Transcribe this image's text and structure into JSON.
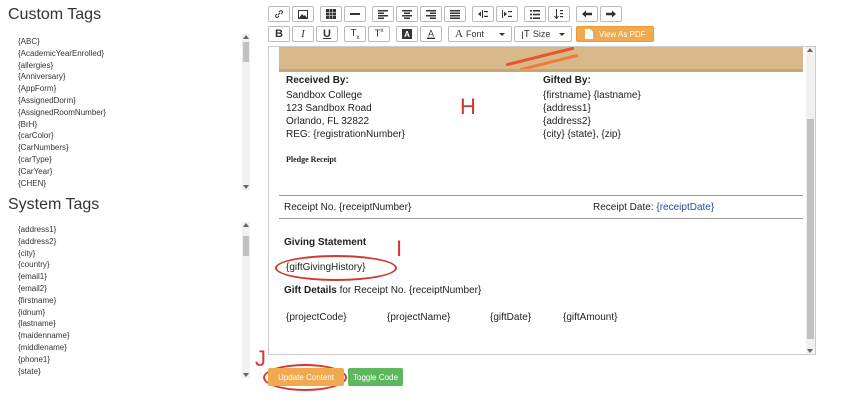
{
  "custom_tags": {
    "title": "Custom Tags",
    "items": [
      "{ABC}",
      "{AcademicYearEnrolled}",
      "{allergies}",
      "{Anniversary}",
      "{AppForm}",
      "{AssignedDorm}",
      "{AssignedRoomNumber}",
      "{BrH}",
      "{carColor}",
      "{CarNumbers}",
      "{carType}",
      "{CarYear}",
      "{CHEN}"
    ]
  },
  "system_tags": {
    "title": "System Tags",
    "items": [
      "{address1}",
      "{address2}",
      "{city}",
      "{country}",
      "{email1}",
      "{email2}",
      "{firstname}",
      "{idnum}",
      "{lastname}",
      "{maidenname}",
      "{middlename}",
      "{phone1}",
      "{state}"
    ]
  },
  "toolbar": {
    "font_label": "Font",
    "size_label": "Size",
    "view_pdf_label": "View As PDF",
    "pdf_color": "#f0a94e"
  },
  "document": {
    "received_by_heading": "Received By:",
    "received_lines": [
      "Sandbox College",
      "123 Sandbox Road",
      "Orlando, FL 32822",
      "REG: {registrationNumber}"
    ],
    "gifted_by_heading": "Gifted By:",
    "gifted_lines": [
      "{firstname} {lastname}",
      "{address1}",
      "{address2}",
      "{city} {state}, {zip}"
    ],
    "pledge_receipt": "Pledge Receipt",
    "receipt_no": "Receipt No. {receiptNumber}",
    "receipt_date_label": "Receipt Date:",
    "receipt_date_value": "{receiptDate}",
    "giving_statement": "Giving Statement",
    "gift_giving_history": "{giftGivingHistory}",
    "gift_details_bold": "Gift Details",
    "gift_details_rest": " for Receipt No. {receiptNumber}",
    "gift_columns": [
      "{projectCode}",
      "{projectName}",
      "{giftDate}",
      "{giftAmount}"
    ]
  },
  "annotations": {
    "h": "H",
    "i": "I",
    "j": "J"
  },
  "buttons": {
    "update_content": "Update Content",
    "toggle_code": "Toggle Code",
    "update_color": "#f0a94e",
    "toggle_color": "#5cb85c"
  },
  "icons": [
    "link-icon",
    "image-icon",
    "table-icon",
    "horizontal-rule-icon",
    "align-left-icon",
    "align-center-icon",
    "align-right-icon",
    "align-justify-icon",
    "outdent-icon",
    "indent-icon",
    "bullet-list-icon",
    "sort-icon",
    "undo-icon",
    "redo-icon",
    "bold-icon",
    "italic-icon",
    "underline-icon",
    "subscript-icon",
    "superscript-icon",
    "highlight-icon",
    "text-color-icon",
    "font-icon",
    "size-icon",
    "pdf-icon"
  ]
}
